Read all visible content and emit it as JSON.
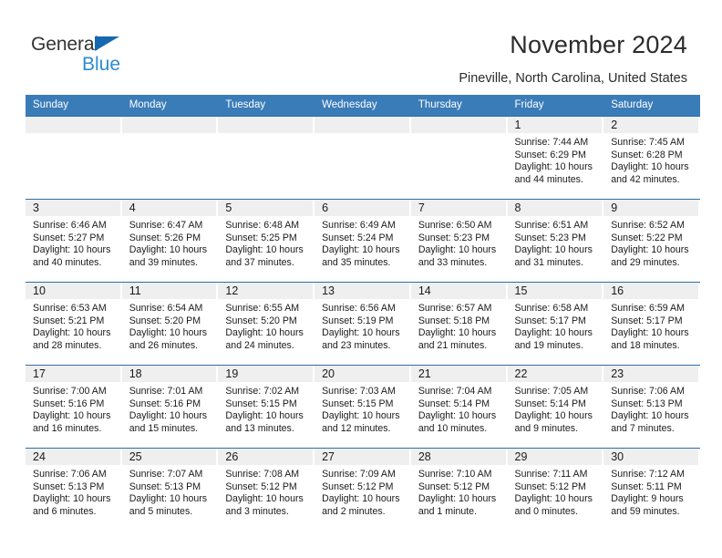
{
  "brand": {
    "line1": "General",
    "line2": "Blue",
    "triangle_color": "#1669b0",
    "text_color": "#333333",
    "blue_text_color": "#2e8bd0"
  },
  "header": {
    "title": "November 2024",
    "subtitle": "Pineville, North Carolina, United States"
  },
  "theme": {
    "header_blue": "#3a7cb8",
    "row_border_blue": "#2e6ea8",
    "daynum_band": "#efefef"
  },
  "calendar": {
    "weekday_headers": [
      "Sunday",
      "Monday",
      "Tuesday",
      "Wednesday",
      "Thursday",
      "Friday",
      "Saturday"
    ],
    "weeks": [
      [
        {
          "day": "",
          "sunrise": "",
          "sunset": "",
          "daylight": ""
        },
        {
          "day": "",
          "sunrise": "",
          "sunset": "",
          "daylight": ""
        },
        {
          "day": "",
          "sunrise": "",
          "sunset": "",
          "daylight": ""
        },
        {
          "day": "",
          "sunrise": "",
          "sunset": "",
          "daylight": ""
        },
        {
          "day": "",
          "sunrise": "",
          "sunset": "",
          "daylight": ""
        },
        {
          "day": "1",
          "sunrise": "Sunrise: 7:44 AM",
          "sunset": "Sunset: 6:29 PM",
          "daylight": "Daylight: 10 hours and 44 minutes."
        },
        {
          "day": "2",
          "sunrise": "Sunrise: 7:45 AM",
          "sunset": "Sunset: 6:28 PM",
          "daylight": "Daylight: 10 hours and 42 minutes."
        }
      ],
      [
        {
          "day": "3",
          "sunrise": "Sunrise: 6:46 AM",
          "sunset": "Sunset: 5:27 PM",
          "daylight": "Daylight: 10 hours and 40 minutes."
        },
        {
          "day": "4",
          "sunrise": "Sunrise: 6:47 AM",
          "sunset": "Sunset: 5:26 PM",
          "daylight": "Daylight: 10 hours and 39 minutes."
        },
        {
          "day": "5",
          "sunrise": "Sunrise: 6:48 AM",
          "sunset": "Sunset: 5:25 PM",
          "daylight": "Daylight: 10 hours and 37 minutes."
        },
        {
          "day": "6",
          "sunrise": "Sunrise: 6:49 AM",
          "sunset": "Sunset: 5:24 PM",
          "daylight": "Daylight: 10 hours and 35 minutes."
        },
        {
          "day": "7",
          "sunrise": "Sunrise: 6:50 AM",
          "sunset": "Sunset: 5:23 PM",
          "daylight": "Daylight: 10 hours and 33 minutes."
        },
        {
          "day": "8",
          "sunrise": "Sunrise: 6:51 AM",
          "sunset": "Sunset: 5:23 PM",
          "daylight": "Daylight: 10 hours and 31 minutes."
        },
        {
          "day": "9",
          "sunrise": "Sunrise: 6:52 AM",
          "sunset": "Sunset: 5:22 PM",
          "daylight": "Daylight: 10 hours and 29 minutes."
        }
      ],
      [
        {
          "day": "10",
          "sunrise": "Sunrise: 6:53 AM",
          "sunset": "Sunset: 5:21 PM",
          "daylight": "Daylight: 10 hours and 28 minutes."
        },
        {
          "day": "11",
          "sunrise": "Sunrise: 6:54 AM",
          "sunset": "Sunset: 5:20 PM",
          "daylight": "Daylight: 10 hours and 26 minutes."
        },
        {
          "day": "12",
          "sunrise": "Sunrise: 6:55 AM",
          "sunset": "Sunset: 5:20 PM",
          "daylight": "Daylight: 10 hours and 24 minutes."
        },
        {
          "day": "13",
          "sunrise": "Sunrise: 6:56 AM",
          "sunset": "Sunset: 5:19 PM",
          "daylight": "Daylight: 10 hours and 23 minutes."
        },
        {
          "day": "14",
          "sunrise": "Sunrise: 6:57 AM",
          "sunset": "Sunset: 5:18 PM",
          "daylight": "Daylight: 10 hours and 21 minutes."
        },
        {
          "day": "15",
          "sunrise": "Sunrise: 6:58 AM",
          "sunset": "Sunset: 5:17 PM",
          "daylight": "Daylight: 10 hours and 19 minutes."
        },
        {
          "day": "16",
          "sunrise": "Sunrise: 6:59 AM",
          "sunset": "Sunset: 5:17 PM",
          "daylight": "Daylight: 10 hours and 18 minutes."
        }
      ],
      [
        {
          "day": "17",
          "sunrise": "Sunrise: 7:00 AM",
          "sunset": "Sunset: 5:16 PM",
          "daylight": "Daylight: 10 hours and 16 minutes."
        },
        {
          "day": "18",
          "sunrise": "Sunrise: 7:01 AM",
          "sunset": "Sunset: 5:16 PM",
          "daylight": "Daylight: 10 hours and 15 minutes."
        },
        {
          "day": "19",
          "sunrise": "Sunrise: 7:02 AM",
          "sunset": "Sunset: 5:15 PM",
          "daylight": "Daylight: 10 hours and 13 minutes."
        },
        {
          "day": "20",
          "sunrise": "Sunrise: 7:03 AM",
          "sunset": "Sunset: 5:15 PM",
          "daylight": "Daylight: 10 hours and 12 minutes."
        },
        {
          "day": "21",
          "sunrise": "Sunrise: 7:04 AM",
          "sunset": "Sunset: 5:14 PM",
          "daylight": "Daylight: 10 hours and 10 minutes."
        },
        {
          "day": "22",
          "sunrise": "Sunrise: 7:05 AM",
          "sunset": "Sunset: 5:14 PM",
          "daylight": "Daylight: 10 hours and 9 minutes."
        },
        {
          "day": "23",
          "sunrise": "Sunrise: 7:06 AM",
          "sunset": "Sunset: 5:13 PM",
          "daylight": "Daylight: 10 hours and 7 minutes."
        }
      ],
      [
        {
          "day": "24",
          "sunrise": "Sunrise: 7:06 AM",
          "sunset": "Sunset: 5:13 PM",
          "daylight": "Daylight: 10 hours and 6 minutes."
        },
        {
          "day": "25",
          "sunrise": "Sunrise: 7:07 AM",
          "sunset": "Sunset: 5:13 PM",
          "daylight": "Daylight: 10 hours and 5 minutes."
        },
        {
          "day": "26",
          "sunrise": "Sunrise: 7:08 AM",
          "sunset": "Sunset: 5:12 PM",
          "daylight": "Daylight: 10 hours and 3 minutes."
        },
        {
          "day": "27",
          "sunrise": "Sunrise: 7:09 AM",
          "sunset": "Sunset: 5:12 PM",
          "daylight": "Daylight: 10 hours and 2 minutes."
        },
        {
          "day": "28",
          "sunrise": "Sunrise: 7:10 AM",
          "sunset": "Sunset: 5:12 PM",
          "daylight": "Daylight: 10 hours and 1 minute."
        },
        {
          "day": "29",
          "sunrise": "Sunrise: 7:11 AM",
          "sunset": "Sunset: 5:12 PM",
          "daylight": "Daylight: 10 hours and 0 minutes."
        },
        {
          "day": "30",
          "sunrise": "Sunrise: 7:12 AM",
          "sunset": "Sunset: 5:11 PM",
          "daylight": "Daylight: 9 hours and 59 minutes."
        }
      ]
    ]
  }
}
